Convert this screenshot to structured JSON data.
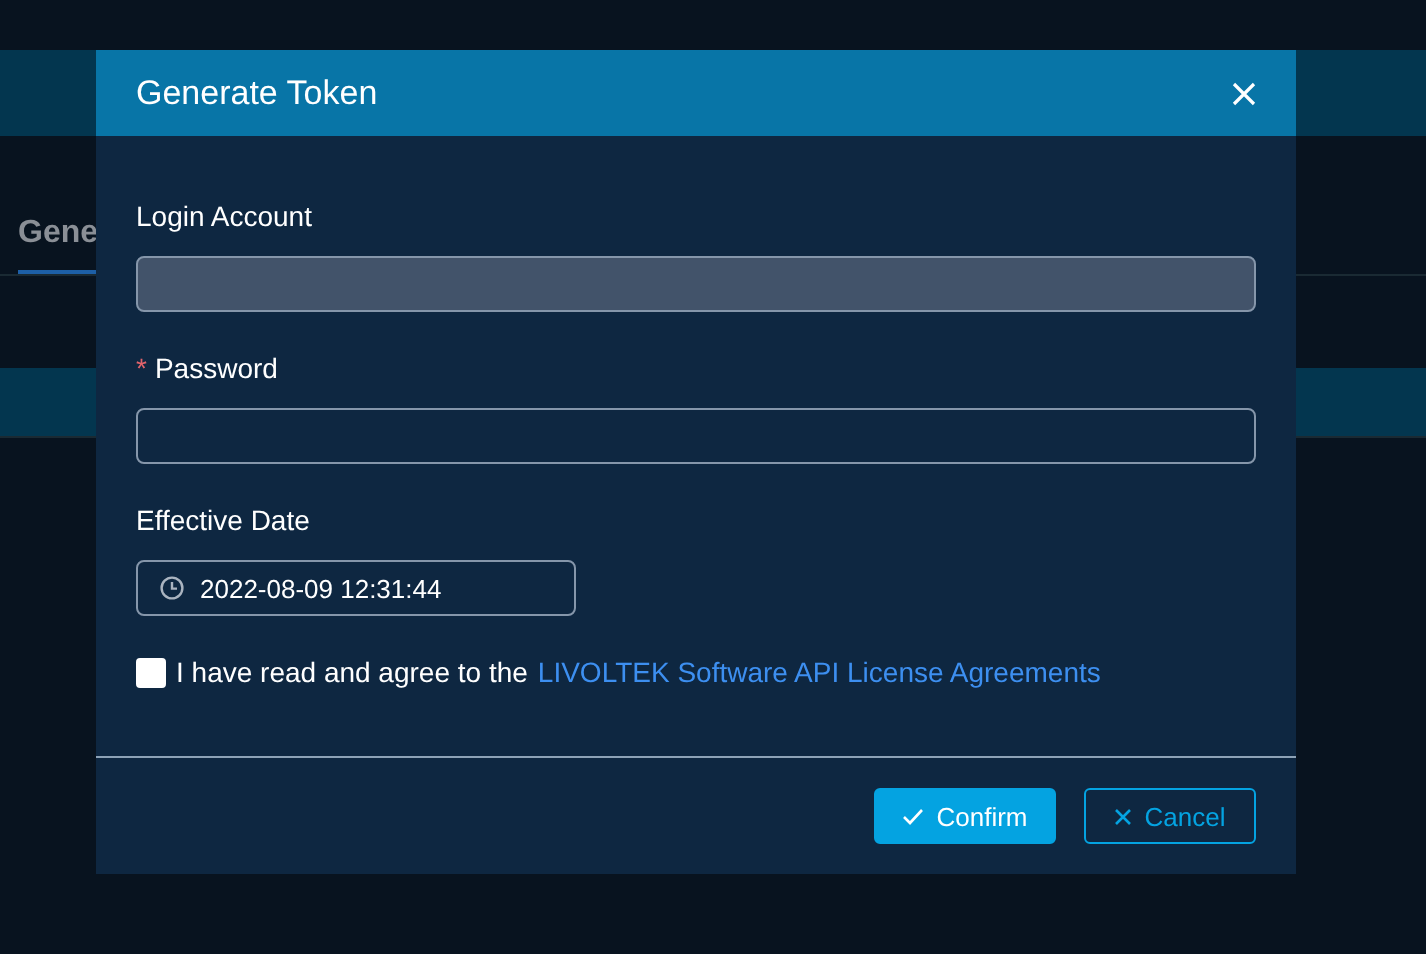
{
  "background": {
    "tab_label": "Gene"
  },
  "dialog": {
    "title": "Generate Token",
    "fields": [
      {
        "label": "Login Account",
        "disabled": true,
        "kind": "text"
      },
      {
        "label": "Password",
        "required_mark": "*",
        "disabled": false,
        "kind": "password"
      },
      {
        "label": "Effective Date",
        "disabled": false,
        "kind": "date",
        "value": "2022-08-09 12:31:44"
      }
    ],
    "agreement": {
      "checked": false,
      "text": "I have read and agree to the",
      "link": "LIVOLTEK Software API License Agreements"
    },
    "buttons": [
      {
        "label": "Confirm",
        "kind": "primary"
      },
      {
        "label": "Cancel",
        "kind": "secondary"
      }
    ]
  }
}
